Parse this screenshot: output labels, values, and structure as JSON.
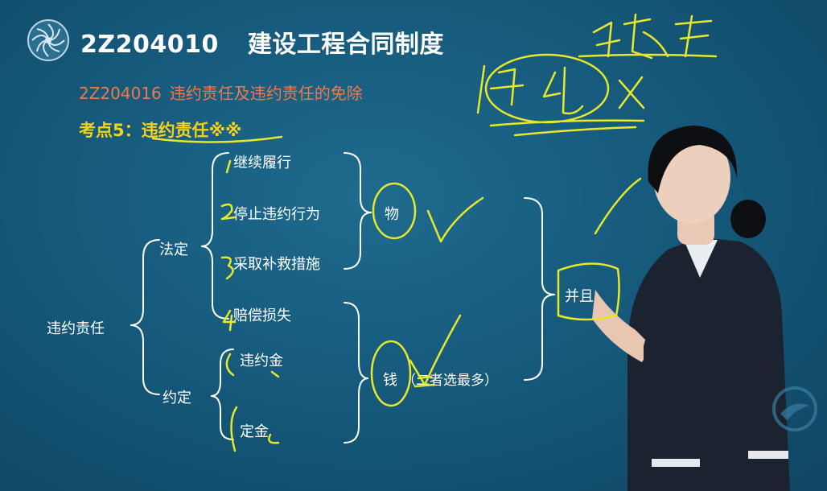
{
  "header": {
    "chapter_code": "2Z204010",
    "chapter_title": "建设工程合同制度"
  },
  "section": {
    "code": "2Z204016",
    "title": "违约责任及违约责任的免除"
  },
  "point": {
    "label": "考点5：",
    "title": "违约责任",
    "marks": "※※"
  },
  "tree": {
    "root": "违约责任",
    "statutory": {
      "label": "法定",
      "items": [
        "继续履行",
        "停止违约行为",
        "采取补救措施",
        "赔偿损失"
      ]
    },
    "agreed": {
      "label": "约定",
      "items": [
        "违约金",
        "定金"
      ]
    },
    "group_goods": "物",
    "group_money": "钱",
    "group_money_note": "（二者选最多）",
    "combine": "并且"
  },
  "colors": {
    "background": "#165a7c",
    "title": "#ffffff",
    "subtitle": "#f07a4a",
    "point": "#f5d21a",
    "ink": "#e8e82a"
  },
  "icons": [
    "logo-emblem-icon",
    "corner-watermark-icon"
  ]
}
